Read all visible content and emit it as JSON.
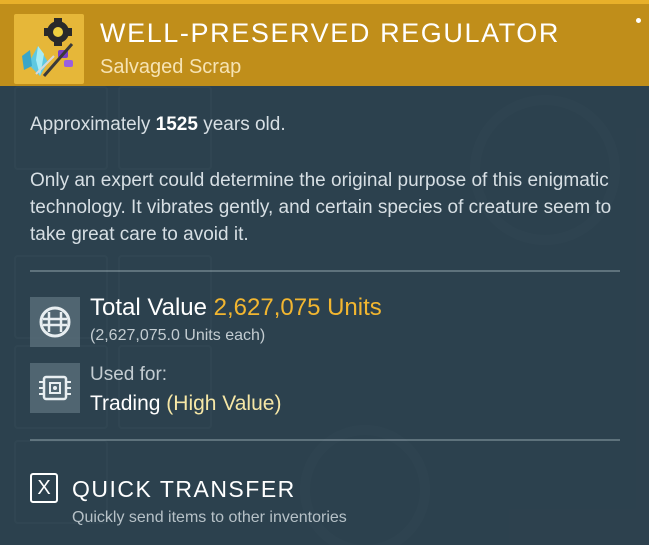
{
  "colors": {
    "header_bg": "#c08e1a",
    "icon_bg": "#e6b739",
    "value_gold": "#f2b630",
    "high_value": "#f6e7a6",
    "panel_bg": "#2e424f"
  },
  "item": {
    "icon": "regulator-item-icon",
    "title": "WELL-PRESERVED REGULATOR",
    "subtitle": "Salvaged Scrap"
  },
  "age": {
    "prefix": "Approximately",
    "years": "1525",
    "suffix": "years old."
  },
  "description": "Only an expert could determine the original purpose of this enigmatic technology. It vibrates gently, and certain species of creature seem to take great care to avoid it.",
  "value": {
    "icon": "units-currency-icon",
    "label": "Total Value",
    "amount": "2,627,075 Units",
    "each": "(2,627,075.0 Units each)"
  },
  "usage": {
    "icon": "trading-chip-icon",
    "label": "Used for:",
    "use": "Trading",
    "qualifier": "(High Value)"
  },
  "quick_transfer": {
    "key": "X",
    "title": "QUICK TRANSFER",
    "description": "Quickly send items to other inventories"
  }
}
